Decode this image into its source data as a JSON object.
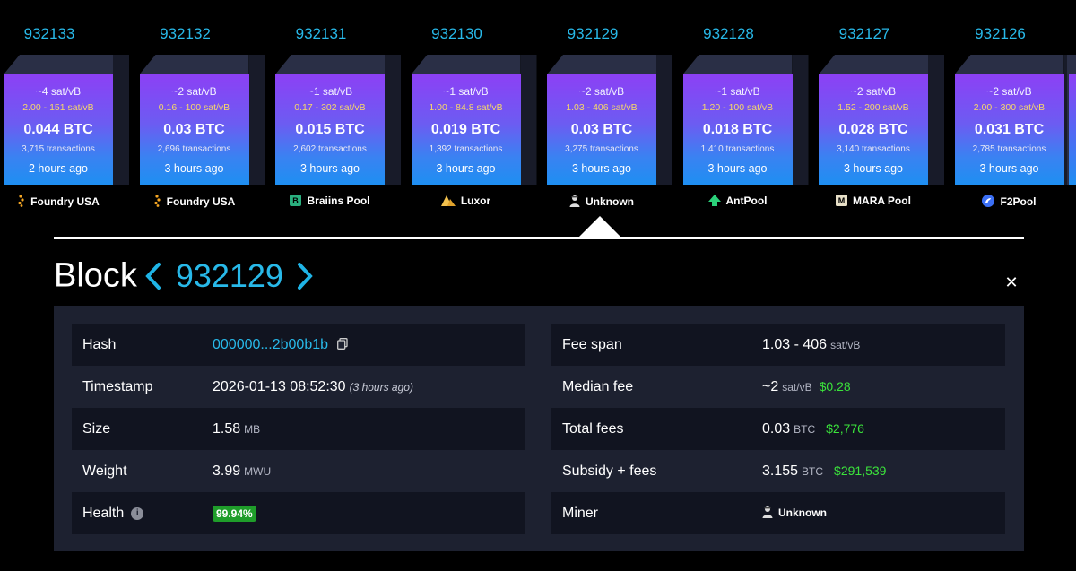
{
  "blocks": [
    {
      "height": "932133",
      "fee": "~4 sat/vB",
      "range": "2.00 - 151 sat/vB",
      "total": "0.044 BTC",
      "tx": "3,715 transactions",
      "ago": "2 hours ago",
      "pool": "Foundry USA",
      "pool_icon": "foundry-icon"
    },
    {
      "height": "932132",
      "fee": "~2 sat/vB",
      "range": "0.16 - 100 sat/vB",
      "total": "0.03 BTC",
      "tx": "2,696 transactions",
      "ago": "3 hours ago",
      "pool": "Foundry USA",
      "pool_icon": "foundry-icon"
    },
    {
      "height": "932131",
      "fee": "~1 sat/vB",
      "range": "0.17 - 302 sat/vB",
      "total": "0.015 BTC",
      "tx": "2,602 transactions",
      "ago": "3 hours ago",
      "pool": "Braiins Pool",
      "pool_icon": "braiins-icon"
    },
    {
      "height": "932130",
      "fee": "~1 sat/vB",
      "range": "1.00 - 84.8 sat/vB",
      "total": "0.019 BTC",
      "tx": "1,392 transactions",
      "ago": "3 hours ago",
      "pool": "Luxor",
      "pool_icon": "luxor-icon"
    },
    {
      "height": "932129",
      "fee": "~2 sat/vB",
      "range": "1.03 - 406 sat/vB",
      "total": "0.03 BTC",
      "tx": "3,275 transactions",
      "ago": "3 hours ago",
      "pool": "Unknown",
      "pool_icon": "unknown-miner-icon"
    },
    {
      "height": "932128",
      "fee": "~1 sat/vB",
      "range": "1.20 - 100 sat/vB",
      "total": "0.018 BTC",
      "tx": "1,410 transactions",
      "ago": "3 hours ago",
      "pool": "AntPool",
      "pool_icon": "antpool-icon"
    },
    {
      "height": "932127",
      "fee": "~2 sat/vB",
      "range": "1.52 - 200 sat/vB",
      "total": "0.028 BTC",
      "tx": "3,140 transactions",
      "ago": "3 hours ago",
      "pool": "MARA Pool",
      "pool_icon": "mara-icon"
    },
    {
      "height": "932126",
      "fee": "~2 sat/vB",
      "range": "2.00 - 300 sat/vB",
      "total": "0.031 BTC",
      "tx": "2,785 transactions",
      "ago": "3 hours ago",
      "pool": "F2Pool",
      "pool_icon": "f2pool-icon"
    }
  ],
  "heading": {
    "title": "Block",
    "height": "932129",
    "prev_icon": "chevron-left-icon",
    "next_icon": "chevron-right-icon",
    "close_glyph": "✕"
  },
  "details": {
    "hash": {
      "label": "Hash",
      "value": "000000...2b00b1b",
      "icon": "copy-icon"
    },
    "timestamp": {
      "label": "Timestamp",
      "value": "2026-01-13 08:52:30",
      "ago": "(3 hours ago)"
    },
    "size": {
      "label": "Size",
      "value": "1.58",
      "unit": "MB"
    },
    "weight": {
      "label": "Weight",
      "value": "3.99",
      "unit": "MWU"
    },
    "health": {
      "label": "Health",
      "value": "99.94%",
      "icon": "info-icon"
    },
    "fee_span": {
      "label": "Fee span",
      "value": "1.03 - 406",
      "unit": "sat/vB"
    },
    "median_fee": {
      "label": "Median fee",
      "value": "~2",
      "unit": "sat/vB",
      "usd": "$0.28"
    },
    "total_fees": {
      "label": "Total fees",
      "value": "0.03",
      "unit": "BTC",
      "usd": "$2,776"
    },
    "subsidy": {
      "label": "Subsidy + fees",
      "value": "3.155",
      "unit": "BTC",
      "usd": "$291,539"
    },
    "miner": {
      "label": "Miner",
      "value": "Unknown",
      "icon": "unknown-miner-icon"
    }
  },
  "colors": {
    "accent": "#28b9e9",
    "green": "#3be33b",
    "badge": "#1f9d2a",
    "panel": "#1d2130"
  }
}
